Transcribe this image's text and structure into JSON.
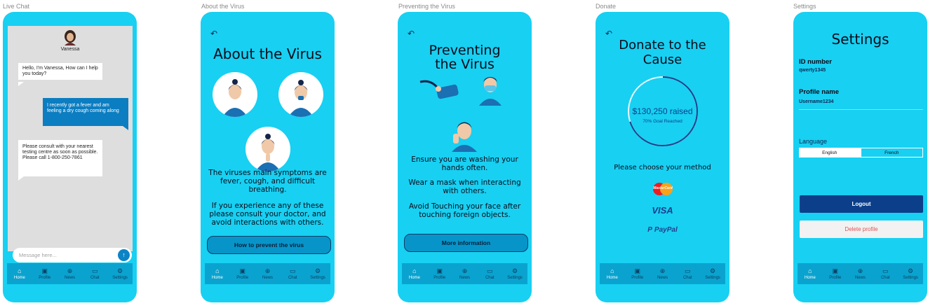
{
  "frames": {
    "chat": "Live Chat",
    "about": "About the Virus",
    "prevent": "Preventing the Virus",
    "donate": "Donate",
    "settings": "Settings"
  },
  "nav": [
    "Home",
    "Profile",
    "News",
    "Chat",
    "Settings"
  ],
  "chat": {
    "agent_name": "Vanessa",
    "messages": [
      "Hello, I'm Vanessa, How can I help you today?",
      "I recently got a fever and am feeling a dry cough coming along",
      "Please consult with your nearest testing centre as soon as possible. Please call 1-800-250-7861"
    ],
    "input_placeholder": "Message here..."
  },
  "about": {
    "title": "About the Virus",
    "para1": "The viruses main symptoms are fever, cough, and difficult breathing.",
    "para2": "If you experience any of these please consult your doctor, and avoid interactions with others.",
    "button": "How to prevent the virus"
  },
  "prevent": {
    "title": "Preventing the Virus",
    "tips": [
      "Ensure you are washing your hands often.",
      "Wear a mask when interacting with others.",
      "Avoid Touching your face after touching foreign objects."
    ],
    "button": "More information"
  },
  "donate": {
    "title": "Donate to the Cause",
    "raised": "$130,250 raised",
    "goal": "70% Goal Reached",
    "goal_fraction": 0.7,
    "choose": "Please choose your method",
    "methods": [
      "MasterCard",
      "VISA",
      "PayPal"
    ]
  },
  "settings": {
    "title": "Settings",
    "id_label": "ID number",
    "id_value": "qwerty1345",
    "profile_label": "Profile name",
    "profile_value": "Username1234",
    "language_label": "Language",
    "languages": [
      "English",
      "French"
    ],
    "logout": "Logout",
    "delete": "Delete profile"
  },
  "colors": {
    "phone_bg": "#18d0f2",
    "navbar": "#0aa3cf",
    "accent_dark": "#0b3f8a",
    "bubble_out": "#0b7dc1"
  }
}
